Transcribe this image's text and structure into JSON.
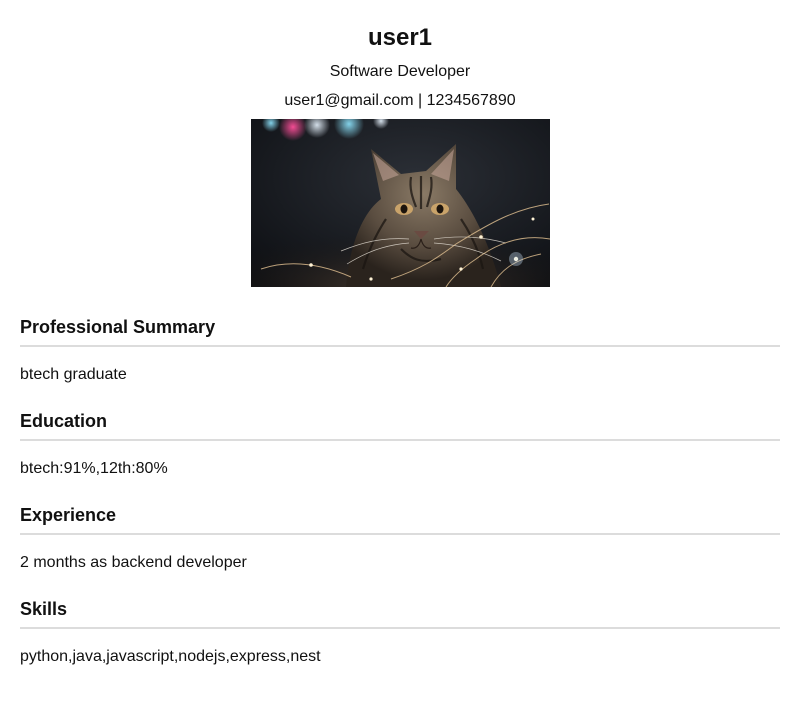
{
  "header": {
    "name": "user1",
    "title": "Software Developer",
    "email": "user1@gmail.com",
    "separator": "|",
    "phone": "1234567890"
  },
  "photo": {
    "subject": "tabby-kitten-photo"
  },
  "sections": [
    {
      "heading": "Professional Summary",
      "body": "btech graduate"
    },
    {
      "heading": "Education",
      "body": "btech:91%,12th:80%"
    },
    {
      "heading": "Experience",
      "body": "2 months as backend developer"
    },
    {
      "heading": "Skills",
      "body": "python,java,javascript,nodejs,express,nest"
    }
  ]
}
